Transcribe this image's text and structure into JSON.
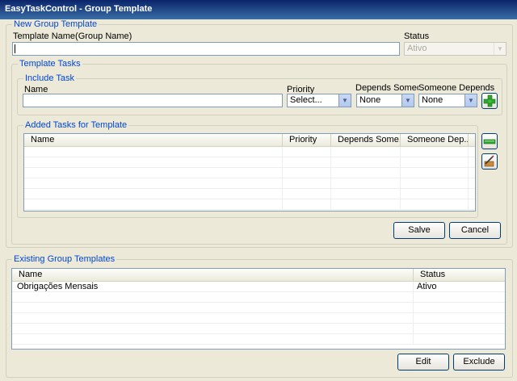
{
  "window": {
    "title": "EasyTaskControl - Group Template"
  },
  "new_group": {
    "legend": "New Group Template",
    "name_label": "Template Name(Group Name)",
    "name_value": "",
    "status_label": "Status",
    "status_value": "Ativo"
  },
  "template_tasks": {
    "legend": "Template Tasks",
    "include_task": {
      "legend": "Include Task",
      "name_label": "Name",
      "name_value": "",
      "priority_label": "Priority",
      "priority_value": "Select...",
      "depends_someone_label": "Depends Someone",
      "depends_someone_value": "None",
      "someone_depends_label": "Someone Depends",
      "someone_depends_value": "None"
    },
    "added_tasks": {
      "legend": "Added Tasks for Template",
      "columns": [
        "Name",
        "Priority",
        "Depends Some...",
        "Someone Dep..."
      ],
      "rows": []
    },
    "save_label": "Salve",
    "cancel_label": "Cancel"
  },
  "existing": {
    "legend": "Existing Group Templates",
    "columns": [
      "Name",
      "Status"
    ],
    "rows": [
      {
        "name": "Obrigações Mensais",
        "status": "Ativo"
      }
    ],
    "edit_label": "Edit",
    "exclude_label": "Exclude"
  },
  "colors": {
    "legend_text": "#0046d5",
    "title_bar": "#0a246a",
    "dialog_bg": "#ece9d8"
  },
  "icons": [
    "add-icon",
    "remove-icon",
    "edit-icon",
    "dropdown-arrow-icon"
  ]
}
